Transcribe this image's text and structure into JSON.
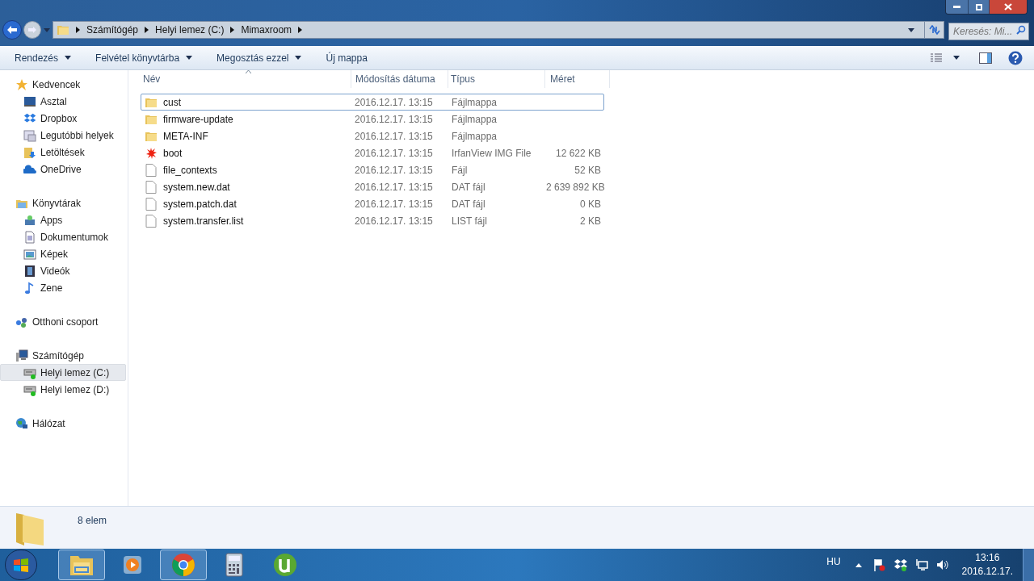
{
  "address_bar": {
    "crumbs": [
      "Számítógép",
      "Helyi lemez (C:)",
      "Mimaxroom"
    ]
  },
  "search": {
    "placeholder": "Keresés: Mi..."
  },
  "toolbar": {
    "buttons": [
      {
        "label": "Rendezés",
        "has_menu": true
      },
      {
        "label": "Felvétel könyvtárba",
        "has_menu": true
      },
      {
        "label": "Megosztás ezzel",
        "has_menu": true
      },
      {
        "label": "Új mappa",
        "has_menu": false
      }
    ]
  },
  "sidebar": {
    "groups": [
      {
        "label": "Kedvencek",
        "kind": "star",
        "selected": false,
        "children": [
          {
            "label": "Asztal",
            "kind": "desktop",
            "selected": false
          },
          {
            "label": "Dropbox",
            "kind": "dropbox",
            "selected": false
          },
          {
            "label": "Legutóbbi helyek",
            "kind": "recent",
            "selected": false
          },
          {
            "label": "Letöltések",
            "kind": "download",
            "selected": false
          },
          {
            "label": "OneDrive",
            "kind": "cloud",
            "selected": false
          }
        ]
      },
      {
        "label": "Könyvtárak",
        "kind": "library",
        "selected": false,
        "children": [
          {
            "label": "Apps",
            "kind": "apps",
            "selected": false
          },
          {
            "label": "Dokumentumok",
            "kind": "document",
            "selected": false
          },
          {
            "label": "Képek",
            "kind": "picture",
            "selected": false
          },
          {
            "label": "Videók",
            "kind": "film",
            "selected": false
          },
          {
            "label": "Zene",
            "kind": "music",
            "selected": false
          }
        ]
      },
      {
        "label": "Otthoni csoport",
        "kind": "homegroup",
        "selected": false
      },
      {
        "label": "Számítógép",
        "kind": "computer",
        "selected": false,
        "children": [
          {
            "label": "Helyi lemez (C:)",
            "kind": "drive",
            "selected": true
          },
          {
            "label": "Helyi lemez (D:)",
            "kind": "drive",
            "selected": false
          }
        ]
      },
      {
        "label": "Hálózat",
        "kind": "network",
        "selected": false
      }
    ]
  },
  "table": {
    "columns": [
      {
        "label": "Név",
        "sorted": true
      },
      {
        "label": "Módosítás dátuma",
        "sorted": false
      },
      {
        "label": "Típus",
        "sorted": false
      },
      {
        "label": "Méret",
        "sorted": false
      }
    ],
    "rows": [
      {
        "name": "cust",
        "kind": "folder",
        "date": "2016.12.17. 13:15",
        "type": "Fájlmappa",
        "size": "",
        "focused": true
      },
      {
        "name": "firmware-update",
        "kind": "folder",
        "date": "2016.12.17. 13:15",
        "type": "Fájlmappa",
        "size": "",
        "focused": false
      },
      {
        "name": "META-INF",
        "kind": "folder",
        "date": "2016.12.17. 13:15",
        "type": "Fájlmappa",
        "size": "",
        "focused": false
      },
      {
        "name": "boot",
        "kind": "image",
        "date": "2016.12.17. 13:15",
        "type": "IrfanView IMG File",
        "size": "12 622 KB",
        "focused": false
      },
      {
        "name": "file_contexts",
        "kind": "file",
        "date": "2016.12.17. 13:15",
        "type": "Fájl",
        "size": "52 KB",
        "focused": false
      },
      {
        "name": "system.new.dat",
        "kind": "file",
        "date": "2016.12.17. 13:15",
        "type": "DAT fájl",
        "size": "2 639 892 KB",
        "focused": false
      },
      {
        "name": "system.patch.dat",
        "kind": "file",
        "date": "2016.12.17. 13:15",
        "type": "DAT fájl",
        "size": "0 KB",
        "focused": false
      },
      {
        "name": "system.transfer.list",
        "kind": "file",
        "date": "2016.12.17. 13:15",
        "type": "LIST fájl",
        "size": "2 KB",
        "focused": false
      }
    ]
  },
  "status_bar": {
    "count": "8 elem"
  },
  "taskbar": {
    "apps": [
      {
        "kind": "explorer",
        "active": true
      },
      {
        "kind": "media",
        "active": false
      },
      {
        "kind": "chrome",
        "active": true
      },
      {
        "kind": "calculator",
        "active": false
      },
      {
        "kind": "torrent",
        "active": false
      }
    ],
    "language": "HU",
    "time": "13:16",
    "date": "2016.12.17."
  }
}
